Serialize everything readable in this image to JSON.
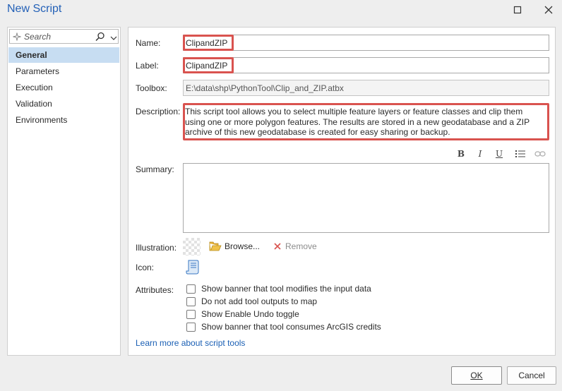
{
  "window": {
    "title": "New Script"
  },
  "search": {
    "placeholder": "Search"
  },
  "nav": {
    "items": [
      {
        "label": "General",
        "selected": true
      },
      {
        "label": "Parameters"
      },
      {
        "label": "Execution"
      },
      {
        "label": "Validation"
      },
      {
        "label": "Environments"
      }
    ]
  },
  "general": {
    "name_label": "Name:",
    "name_value": "ClipandZIP",
    "label_label": "Label:",
    "label_value": "ClipandZIP",
    "toolbox_label": "Toolbox:",
    "toolbox_value": "E:\\data\\shp\\PythonTool\\Clip_and_ZIP.atbx",
    "description_label": "Description:",
    "description_value": "This script tool allows you to select multiple feature layers or feature classes and clip them using one or more polygon features. The results are stored in a new geodatabase and a ZIP archive of this new geodatabase is created for easy sharing or backup.",
    "format_bold": "B",
    "format_italic": "I",
    "format_underline": "U",
    "summary_label": "Summary:",
    "summary_value": "",
    "illustration_label": "Illustration:",
    "browse_label": "Browse...",
    "remove_label": "Remove",
    "icon_label": "Icon:",
    "attributes_label": "Attributes:",
    "attributes": [
      {
        "label": "Show banner that tool modifies the input data",
        "checked": false
      },
      {
        "label": "Do not add tool outputs to map",
        "checked": false
      },
      {
        "label": "Show Enable Undo toggle",
        "checked": false
      },
      {
        "label": "Show banner that tool consumes ArcGIS credits",
        "checked": false
      }
    ],
    "learn_more": "Learn more about script tools"
  },
  "footer": {
    "ok_label": "OK",
    "cancel_label": "Cancel"
  },
  "colors": {
    "highlight": "#d9534f",
    "title": "#2461b7",
    "selection": "#c7ddf2",
    "link": "#1a5fb4"
  },
  "icons": [
    "sparkle-icon",
    "search-icon",
    "chevron-down-icon",
    "maximize-icon",
    "close-icon",
    "bold-icon",
    "italic-icon",
    "underline-icon",
    "list-icon",
    "link-icon",
    "folder-open-icon",
    "remove-x-icon",
    "script-scroll-icon"
  ]
}
